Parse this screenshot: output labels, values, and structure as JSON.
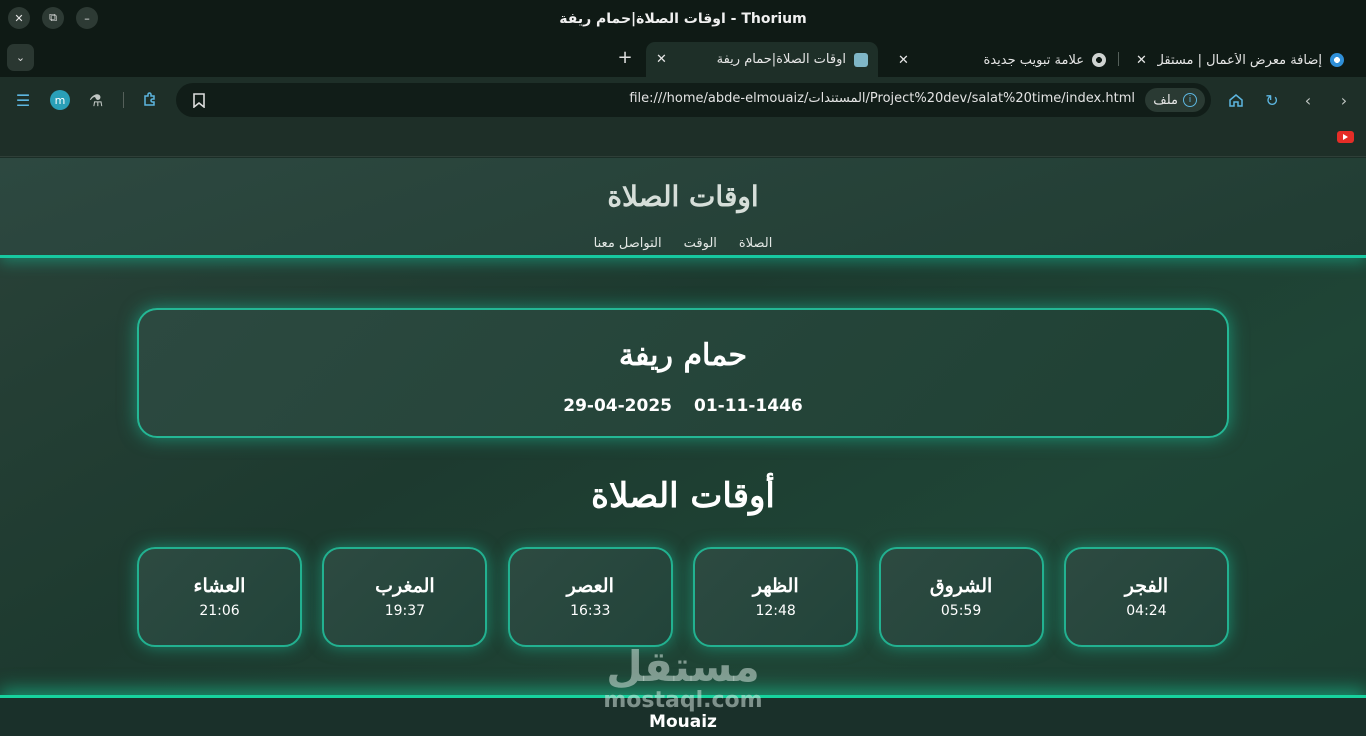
{
  "window": {
    "title": "اوقات الصلاة|حمام ريفة - Thorium",
    "close": "✕",
    "restore": "⧉",
    "minimize": "–"
  },
  "tabs": {
    "dropdown": "⌄",
    "new_tab": "+",
    "items": [
      {
        "label": "اوقات الصلاة|حمام ريفة",
        "close": "✕",
        "active": true
      },
      {
        "label": "علامة تبويب جديدة",
        "close": "✕",
        "active": false
      },
      {
        "label": "إضافة معرض الأعمال | مستقل",
        "close": "✕",
        "active": false
      }
    ]
  },
  "toolbar": {
    "url": "file:///home/abde-elmouaiz/المستندات/Project%20dev/salat%20time/index.html",
    "chip_label": "ملف",
    "avatar_letter": "m",
    "icons": [
      "menu-icon",
      "avatar",
      "flask-icon",
      "extension-icon",
      "bookmark-icon",
      "info-icon",
      "home-icon",
      "reload-icon",
      "back-icon",
      "forward-icon"
    ]
  },
  "page": {
    "site_title": "اوقات الصلاة",
    "nav": [
      "الصلاة",
      "الوقت",
      "التواصل معنا"
    ],
    "city": "حمام ريفة",
    "hijri_date": "01-11-1446",
    "gregorian_date": "29-04-2025",
    "section_title": "أوقات الصلاة",
    "prayers": [
      {
        "name": "الفجر",
        "time": "04:24"
      },
      {
        "name": "الشروق",
        "time": "05:59"
      },
      {
        "name": "الظهر",
        "time": "12:48"
      },
      {
        "name": "العصر",
        "time": "16:33"
      },
      {
        "name": "المغرب",
        "time": "19:37"
      },
      {
        "name": "العشاء",
        "time": "21:06"
      }
    ],
    "footer": "Mouaiz",
    "watermark_ar": "مستقل",
    "watermark_en": "mostaql.com"
  },
  "colors": {
    "accent_glow": "#17c8a0",
    "page_bg": "#1d3a2f",
    "browser_chrome": "#0f1a15",
    "link_blue": "#5db6e0"
  }
}
